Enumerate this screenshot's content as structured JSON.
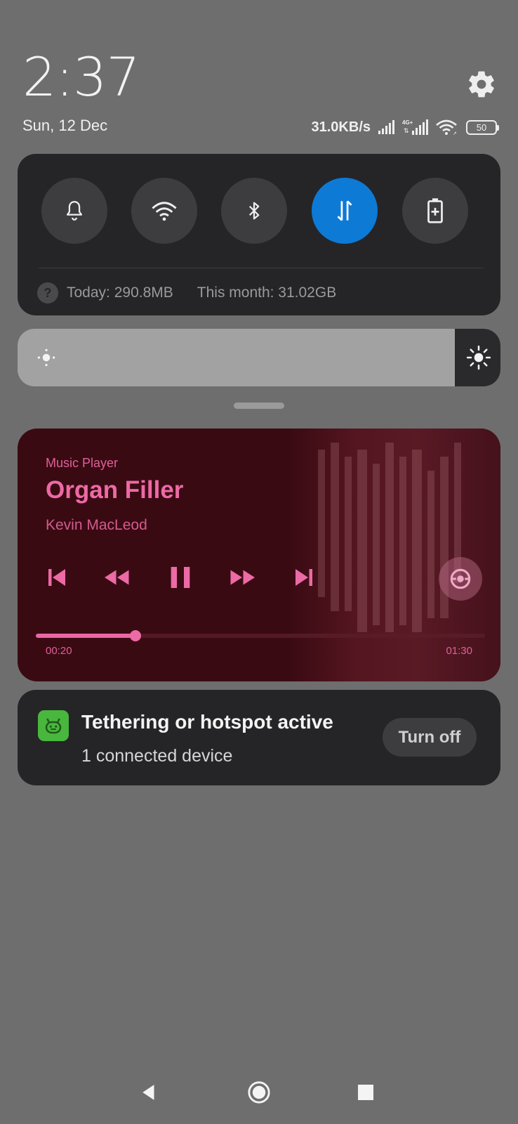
{
  "header": {
    "time": "2:37",
    "date": "Sun, 12 Dec",
    "net_speed": "31.0KB/s",
    "battery": "50",
    "icons": [
      "settings-icon",
      "signal-icon",
      "signal-4g-icon",
      "wifi-icon",
      "battery-icon"
    ]
  },
  "quick_toggles": {
    "items": [
      {
        "name": "sound",
        "icon": "bell-icon",
        "active": false
      },
      {
        "name": "wifi",
        "icon": "wifi-icon",
        "active": false
      },
      {
        "name": "bluetooth",
        "icon": "bluetooth-icon",
        "active": false
      },
      {
        "name": "mobile-data",
        "icon": "data-transfer-icon",
        "active": true
      },
      {
        "name": "battery-saver",
        "icon": "battery-plus-icon",
        "active": false
      }
    ],
    "usage_today": "Today: 290.8MB",
    "usage_month": "This month: 31.02GB",
    "accent_color": "#0d7ad6"
  },
  "brightness": {
    "level": 0.905,
    "icons": [
      "brightness-low-icon",
      "brightness-high-icon"
    ]
  },
  "media": {
    "app_name": "Music Player",
    "title": "Organ Filler",
    "artist": "Kevin MacLeod",
    "elapsed": "00:20",
    "total": "01:30",
    "progress": 0.222,
    "accent_color": "#ec6aa5",
    "controls": [
      "skip-previous-icon",
      "rewind-icon",
      "pause-icon",
      "fast-forward-icon",
      "skip-next-icon"
    ]
  },
  "notification": {
    "title": "Tethering or hotspot active",
    "subtitle": "1 connected device",
    "action_label": "Turn off",
    "icon": "android-icon",
    "icon_color": "#49b73d"
  },
  "navbar": {
    "icons": [
      "back-icon",
      "home-icon",
      "recents-icon"
    ]
  }
}
